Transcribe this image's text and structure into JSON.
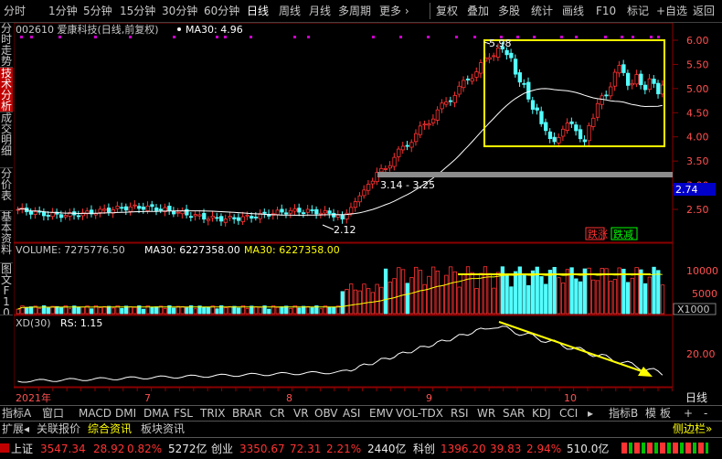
{
  "toolbar": {
    "periods": [
      "分时",
      "1分钟",
      "5分钟",
      "15分钟",
      "30分钟",
      "60分钟",
      "日线",
      "周线",
      "月线",
      "多周期",
      "更多 ›"
    ],
    "active_period": "日线",
    "right_items": [
      "复权",
      "叠加",
      "多股",
      "统计",
      "画线",
      "F10",
      "标记",
      "+自选",
      "返回"
    ]
  },
  "left_tabs": [
    "分时走势",
    "技术分析",
    "成交明细",
    "分价表",
    "基本资料",
    "图文F10"
  ],
  "active_left_tab": "技术分析",
  "main_chart": {
    "stock_title": "002610 爱康科技(日线,前复权)",
    "ma_label": "MA30: 4.96",
    "price_ticks": [
      "6.00",
      "5.50",
      "5.00",
      "4.50",
      "4.00",
      "3.50",
      "3.00",
      "2.50"
    ],
    "current_price_tag": "2.74",
    "annotations": {
      "high": "5.98",
      "low": "2.12",
      "range": "3.14 - 3.25"
    },
    "legend_up": "跌涨",
    "legend_down": "跌减"
  },
  "volume_chart": {
    "label": "VOLUME: 7275776.50",
    "ma_white": "MA30: 6227358.00",
    "ma_yellow": "MA30: 6227358.00",
    "ticks": [
      "10000",
      "5000"
    ],
    "unit": "X1000"
  },
  "indicator_chart": {
    "label": "XD(30)",
    "rs_label": "RS: 1.15",
    "tick": "20.00"
  },
  "x_axis": {
    "labels": [
      "2021年",
      "7",
      "8",
      "9",
      "10"
    ],
    "period_label": "日线"
  },
  "indicator_tabs": [
    "指标A",
    "窗口",
    "MACD",
    "DMI",
    "DMA",
    "FSL",
    "TRIX",
    "BRAR",
    "CR",
    "VR",
    "OBV",
    "ASI",
    "EMV",
    "VOL-TDX",
    "RSI",
    "WR",
    "SAR",
    "KDJ",
    "CCI"
  ],
  "indicator_nav": [
    "▸",
    "指标B",
    "模",
    "板",
    "+",
    "-"
  ],
  "sub_tabs": [
    "扩展◂",
    "关联报价",
    "综合资讯",
    "板块资讯"
  ],
  "active_sub_tab": "综合资讯",
  "side_toggle": "侧边栏»",
  "status": {
    "sh_name": "上证",
    "sh_value": "3547.34",
    "sh_change": "28.92",
    "sh_pct": "0.82%",
    "sh_amount": "5272亿",
    "cy_name": "创业",
    "cy_value": "3350.67",
    "cy_change": "72.31",
    "cy_pct": "2.21%",
    "cy_amount": "2440亿",
    "kc_name": "科创",
    "kc_value": "1396.20",
    "kc_change": "39.83",
    "kc_pct": "2.94%",
    "kc_amount": "510.0亿"
  },
  "colors": {
    "up": "#ff3232",
    "down": "#54ffff",
    "ma": "#ffffff",
    "box": "#ffff00",
    "accent": "#c00000"
  }
}
